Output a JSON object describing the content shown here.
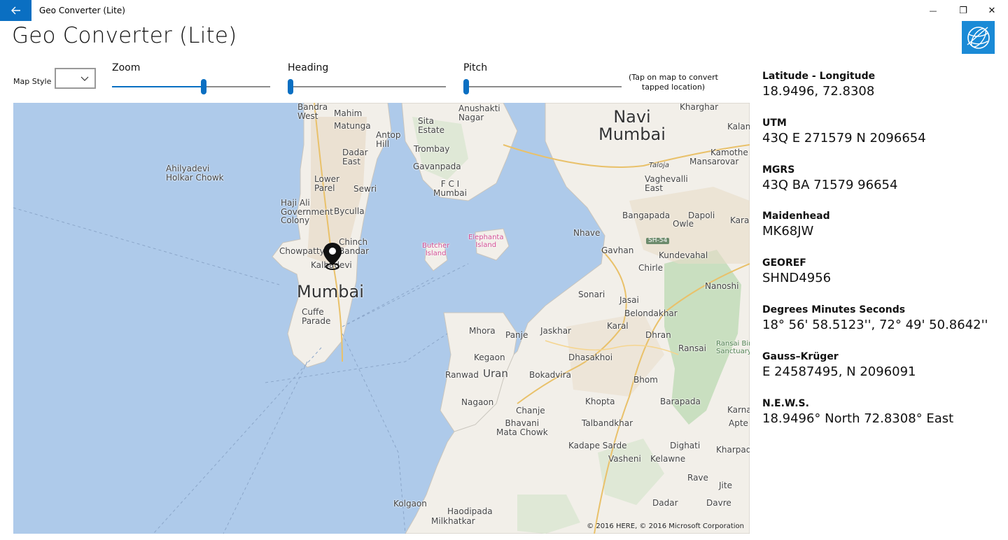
{
  "window": {
    "title": "Geo Converter (Lite)",
    "back_icon": "back-arrow-icon",
    "minimize_glyph": "—",
    "maximize_glyph": "❐",
    "close_glyph": "✕"
  },
  "header": {
    "title": "Geo Converter (Lite)"
  },
  "controls": {
    "map_style_label": "Map Style",
    "map_style_value": "",
    "zoom_label": "Zoom",
    "heading_label": "Heading",
    "pitch_label": "Pitch",
    "zoom_fraction": 0.58,
    "heading_fraction": 0.0,
    "pitch_fraction": 0.0,
    "hint_text": "(Tap on map to convert tapped location)"
  },
  "map": {
    "copyright": "© 2016 HERE, © 2016 Microsoft Corporation",
    "city_large": [
      "Mumbai",
      "Navi Mumbai"
    ],
    "places": [
      "Bandra West",
      "Mahim",
      "Anushakti Nagar",
      "Matunga",
      "Sita Estate",
      "Antop Hill",
      "Dadar East",
      "Trombay",
      "Gavanpada",
      "Lower Parel",
      "Sewri",
      "F C I Mumbai",
      "Haji Ali Government Colony",
      "Byculla",
      "Chinch Bandar",
      "Chowpatty",
      "Kalbadevi",
      "Cuffe Parade",
      "Butcher Island",
      "Elephanta Island",
      "Nhave",
      "Gavhan",
      "Chirle",
      "Sonari",
      "Jasai",
      "Belondakhar",
      "Mhora",
      "Panje",
      "Jaskhar",
      "Karal",
      "Dhran",
      "Kegaon",
      "Ranwad",
      "Uran",
      "Bokadvira",
      "Dhasakhoi",
      "Bhom",
      "Nagaon",
      "Chanje",
      "Bhavani Mata Chowk",
      "Khopta",
      "Barapada",
      "Talbandkhar",
      "Kadape Sarde",
      "Dighati",
      "Vasheni",
      "Kelawne",
      "Rave",
      "Jite",
      "Kolgaon",
      "Haodipada",
      "Milkhatkar",
      "Dadar",
      "Davre",
      "Ahilyadevi Holkar Chowk",
      "Taloja",
      "Mansarovar",
      "Kamothe",
      "Kalamboli",
      "Vaghevalli East",
      "Bangapada",
      "Owle",
      "Dapoli",
      "Kundevahal",
      "Nanoshi",
      "Ransai Bird Sanctuary",
      "Karnala",
      "Apte",
      "Kharpada",
      "Kharghar"
    ],
    "road_badge": "SH-54",
    "pin_icon": "location-pin-icon"
  },
  "results": [
    {
      "label": "Latitude - Longitude",
      "value": "18.9496, 72.8308"
    },
    {
      "label": "UTM",
      "value": "43Q E 271579 N 2096654"
    },
    {
      "label": "MGRS",
      "value": "43Q BA 71579 96654"
    },
    {
      "label": "Maidenhead",
      "value": "MK68JW"
    },
    {
      "label": "GEOREF",
      "value": "SHND4956"
    },
    {
      "label": "Degrees Minutes Seconds",
      "value": "18° 56' 58.5123'', 72° 49' 50.8642''"
    },
    {
      "label": "Gauss–Krüger",
      "value": "E 24587495, N 2096091"
    },
    {
      "label": "N.E.W.S.",
      "value": "18.9496° North 72.8308° East"
    }
  ],
  "colors": {
    "accent": "#0a6fc2",
    "water": "#aecaea",
    "land": "#f2efe9",
    "forest": "#c9dfc0"
  }
}
